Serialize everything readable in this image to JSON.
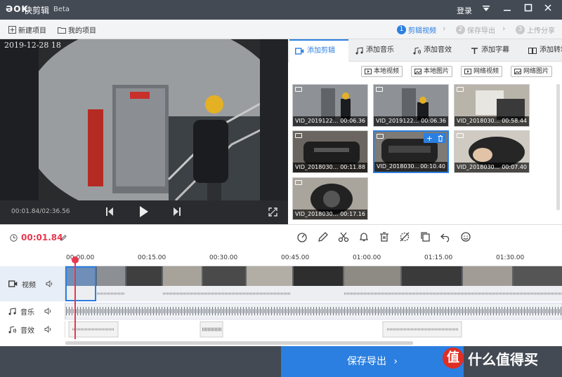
{
  "titlebar": {
    "logo": "ƏOK",
    "app_name": "快剪辑",
    "beta": "Beta",
    "login": "登录",
    "menu_icon": "dropdown-icon",
    "min_icon": "minimize-icon",
    "max_icon": "maximize-icon",
    "close_icon": "close-icon"
  },
  "toolbar": {
    "new_project": "新建项目",
    "my_projects": "我的项目",
    "steps": [
      {
        "num": "1",
        "label": "剪辑视频"
      },
      {
        "num": "2",
        "label": "保存导出"
      },
      {
        "num": "3",
        "label": "上传分享"
      }
    ]
  },
  "preview": {
    "timestamp_overlay": "2019-12-28 18",
    "time_display": "00:01.84/02:36.56",
    "prev_icon": "prev-icon",
    "play_icon": "play-icon",
    "next_icon": "next-icon",
    "fullscreen_icon": "fullscreen-icon"
  },
  "tabs": [
    {
      "label": "添加剪辑",
      "icon": "video-icon"
    },
    {
      "label": "添加音乐",
      "icon": "music-icon"
    },
    {
      "label": "添加音效",
      "icon": "sound-effect-icon"
    },
    {
      "label": "添加字幕",
      "icon": "text-icon"
    },
    {
      "label": "添加转场",
      "icon": "transition-icon"
    }
  ],
  "sources": [
    {
      "label": "本地视频"
    },
    {
      "label": "本地图片"
    },
    {
      "label": "网络视频"
    },
    {
      "label": "网络图片"
    }
  ],
  "clips": [
    {
      "name": "VID_2019122...",
      "duration": "00:06.36"
    },
    {
      "name": "VID_2019122...",
      "duration": "00:06.36"
    },
    {
      "name": "VID_2018030...",
      "duration": "00:58.44"
    },
    {
      "name": "VID_2018030...",
      "duration": "00:11.88"
    },
    {
      "name": "VID_2018030...",
      "duration": "00:10.40"
    },
    {
      "name": "VID_2018030...",
      "duration": "00:07.40"
    },
    {
      "name": "VID_2018030...",
      "duration": "00:17.16"
    }
  ],
  "edit": {
    "current_time": "00:01.84"
  },
  "timeline": {
    "ruler": [
      "00:00.00",
      "00:15.00",
      "00:30.00",
      "00:45.00",
      "01:00.00",
      "01:15.00",
      "01:30.00"
    ],
    "tracks": [
      {
        "label": "视频",
        "icon": "video-icon"
      },
      {
        "label": "音乐",
        "icon": "music-icon"
      },
      {
        "label": "音效",
        "icon": "sound-effect-icon"
      }
    ]
  },
  "bottom": {
    "export_label": "保存导出",
    "watermark_badge": "值",
    "watermark_text": "什么值得买"
  },
  "colors": {
    "accent": "#2b7fe0",
    "playhead": "#e8384f",
    "titlebar": "#434a54"
  }
}
